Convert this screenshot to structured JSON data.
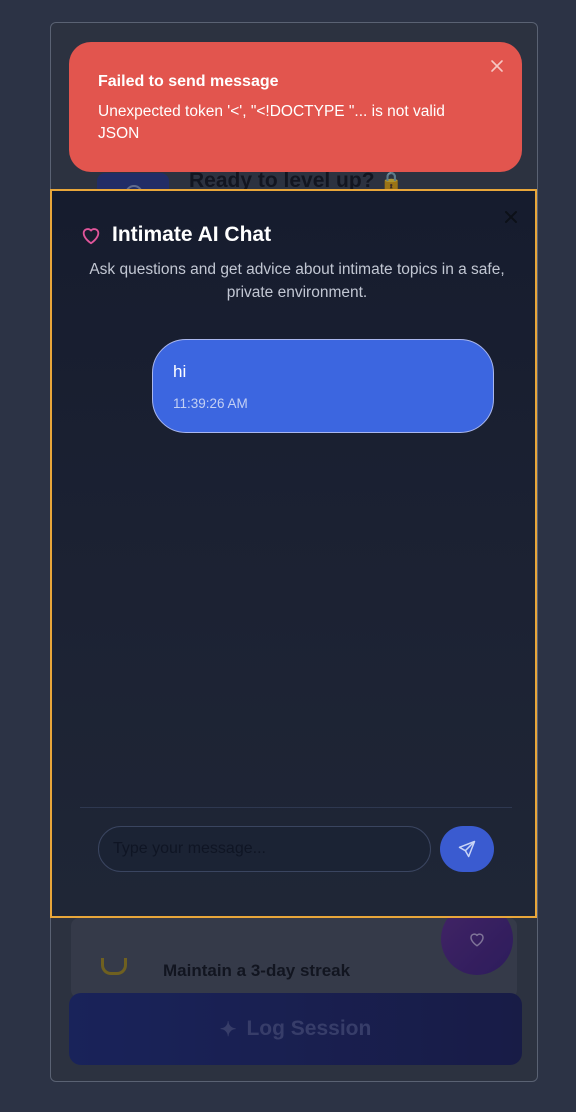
{
  "background": {
    "heading": "Ready to level up?",
    "heading_emoji": "🔒",
    "goal_text": "Maintain a 3-day streak",
    "log_button_label": "Log Session"
  },
  "toast": {
    "title": "Failed to send message",
    "message": "Unexpected token '<', \"<!DOCTYPE \"... is not valid JSON"
  },
  "chat": {
    "title": "Intimate AI Chat",
    "description": "Ask questions and get advice about intimate topics in a safe, private environment.",
    "messages": [
      {
        "role": "user",
        "text": "hi",
        "time": "11:39:26 AM"
      }
    ],
    "input_placeholder": "Type your message...",
    "input_value": ""
  },
  "colors": {
    "toast_bg": "#e2554e",
    "dialog_border": "#e8a63a",
    "user_bubble": "#3c66e0",
    "heart_icon": "#e0559a",
    "send_button": "#3a5bd0"
  }
}
